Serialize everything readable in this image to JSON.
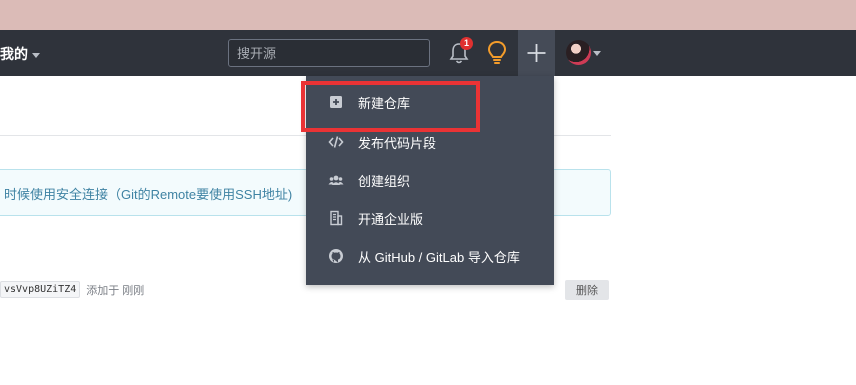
{
  "navbar": {
    "mine_label": "我的",
    "search_placeholder": "搜开源",
    "notification_count": "1"
  },
  "dropdown": {
    "items": [
      {
        "label": "新建仓库",
        "icon": "plus-square-icon"
      },
      {
        "label": "发布代码片段",
        "icon": "code-icon"
      },
      {
        "label": "创建组织",
        "icon": "users-icon"
      },
      {
        "label": "开通企业版",
        "icon": "building-icon"
      },
      {
        "label": "从 GitHub / GitLab 导入仓库",
        "icon": "github-icon"
      }
    ]
  },
  "notice": {
    "text": "时候使用安全连接（Git的Remote要使用SSH地址)"
  },
  "key_row": {
    "fingerprint": "vsVvp8UZiTZ4",
    "added_text": "添加于 刚刚",
    "delete_label": "删除"
  },
  "colors": {
    "navbar_bg": "#2f333b",
    "dropdown_bg": "#434a57",
    "highlight": "#ea3335",
    "bulb": "#f39c2b",
    "badge": "#e03130"
  }
}
